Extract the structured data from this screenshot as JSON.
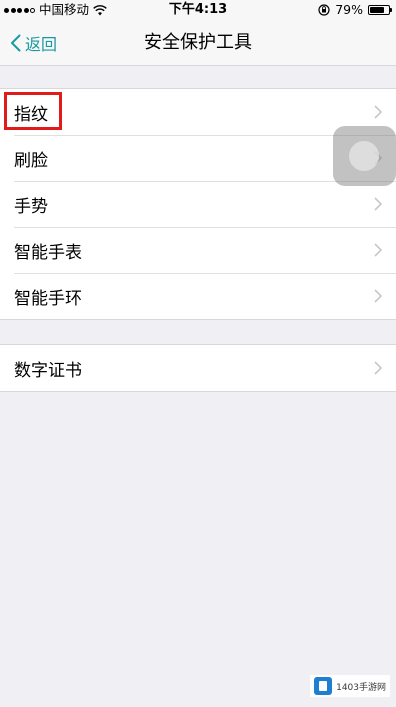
{
  "status_bar": {
    "carrier": "中国移动",
    "time": "下午4:13",
    "battery_percent": "79%",
    "battery_level": 0.79,
    "signal_icon": "signal-dots-icon",
    "wifi_icon": "wifi-icon",
    "lock_icon": "orientation-lock-icon"
  },
  "nav": {
    "back_label": "返回",
    "title": "安全保护工具",
    "accent_color": "#1a9aa0"
  },
  "group1": {
    "items": [
      {
        "label": "指纹"
      },
      {
        "label": "刷脸"
      },
      {
        "label": "手势"
      },
      {
        "label": "智能手表"
      },
      {
        "label": "智能手环"
      }
    ]
  },
  "group2": {
    "items": [
      {
        "label": "数字证书"
      }
    ]
  },
  "highlight_color": "#e01b1b",
  "watermark": {
    "text": "1403手游网"
  }
}
